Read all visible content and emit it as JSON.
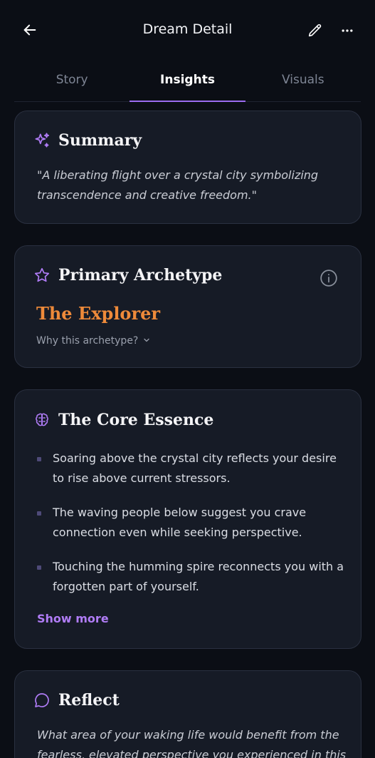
{
  "header": {
    "title": "Dream Detail"
  },
  "tabs": [
    {
      "label": "Story"
    },
    {
      "label": "Insights"
    },
    {
      "label": "Visuals"
    }
  ],
  "summary": {
    "heading": "Summary",
    "text": "\"A liberating flight over a crystal city symbolizing transcendence and creative freedom.\""
  },
  "archetype": {
    "heading": "Primary Archetype",
    "name": "The Explorer",
    "why_label": "Why this archetype?"
  },
  "essence": {
    "heading": "The Core Essence",
    "items": [
      "Soaring above the crystal city reflects your desire to rise above current stressors.",
      "The waving people below suggest you crave connection even while seeking perspective.",
      "Touching the humming spire reconnects you with a forgotten part of yourself."
    ],
    "show_more": "Show more"
  },
  "reflect": {
    "heading": "Reflect",
    "text": "What area of your waking life would benefit from the fearless, elevated perspective you experienced in this"
  },
  "colors": {
    "accent": "#9b6cf0",
    "archetype": "#ee8a3a",
    "background": "#0b0e15",
    "card": "#161b26"
  },
  "icons": [
    "back-arrow-icon",
    "pencil-icon",
    "more-icon",
    "sparkles-icon",
    "star-icon",
    "info-icon",
    "chevron-down-icon",
    "brain-icon",
    "chat-bubble-icon"
  ]
}
